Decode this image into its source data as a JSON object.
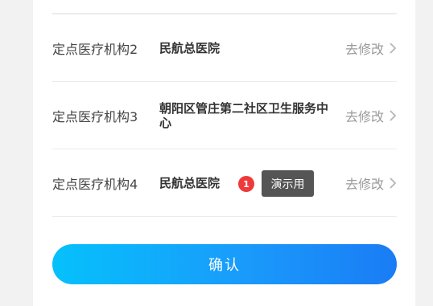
{
  "rows": [
    {
      "label": "定点医疗机构2",
      "value": "民航总医院",
      "action": "去修改"
    },
    {
      "label": "定点医疗机构3",
      "value": "朝阳区管庄第二社区卫生服务中心",
      "action": "去修改"
    },
    {
      "label": "定点医疗机构4",
      "value": "民航总医院",
      "action": "去修改"
    }
  ],
  "confirm_label": "确认",
  "tip": {
    "badge": "1",
    "text": "演示用"
  },
  "colors": {
    "accent_start": "#05c1fb",
    "accent_end": "#1a7cf5",
    "badge_red": "#ee3a3a"
  },
  "icons": {
    "row_action": "chevron-right-icon"
  }
}
